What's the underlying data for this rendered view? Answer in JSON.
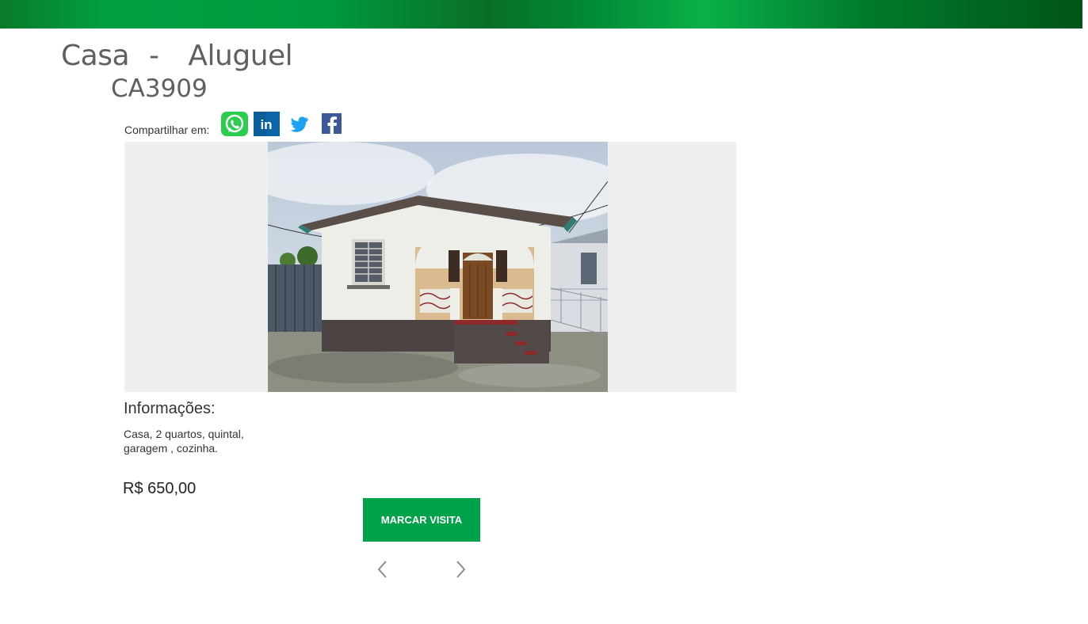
{
  "header": {
    "title_type": "Casa",
    "title_sep": "-",
    "title_deal": "Aluguel",
    "code": "CA3909"
  },
  "share": {
    "label": "Compartilhar em:",
    "icons": [
      "whatsapp-icon",
      "linkedin-icon",
      "twitter-icon",
      "facebook-icon"
    ],
    "linkedin_text": "in"
  },
  "listing": {
    "photo_alt": "Foto do imóvel",
    "info_heading": "Informações:",
    "description": "Casa, 2 quartos, quintal, garagem , cozinha.",
    "price": "R$ 650,00",
    "visit_button": "MARCAR VISITA"
  },
  "colors": {
    "brand_green": "#00a249",
    "title_gray": "#606060",
    "photo_bg": "#efefef"
  }
}
